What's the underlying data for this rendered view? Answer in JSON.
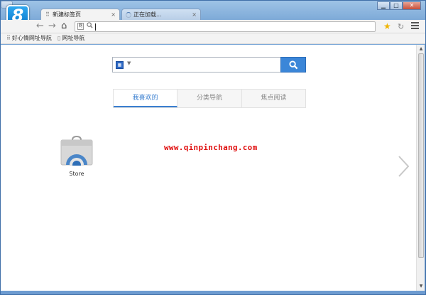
{
  "window": {
    "controls": {
      "minimize": "▁",
      "maximize": "□",
      "close": "✕"
    }
  },
  "tabs": [
    {
      "title": "新建标签页",
      "close": "×",
      "active": true
    },
    {
      "title": "正在加载...",
      "close": "×",
      "active": false
    }
  ],
  "toolbar": {
    "back_icon": "←",
    "forward_icon": "→",
    "home_icon": "⌂",
    "address_value": "",
    "star_icon": "★",
    "reload_icon": "↻"
  },
  "bookmarks": [
    {
      "label": "好心情网址导航"
    },
    {
      "label": "网址导航"
    }
  ],
  "search": {
    "placeholder": ""
  },
  "content_tabs": [
    {
      "label": "我喜欢的",
      "active": true
    },
    {
      "label": "分类导航",
      "active": false
    },
    {
      "label": "焦点阅读",
      "active": false
    }
  ],
  "apps": [
    {
      "label": "Store"
    }
  ],
  "watermark": "www.qinpinchang.com",
  "colors": {
    "accent": "#3b86d8",
    "watermark": "#e01010",
    "frame": "#7aa7d6"
  }
}
